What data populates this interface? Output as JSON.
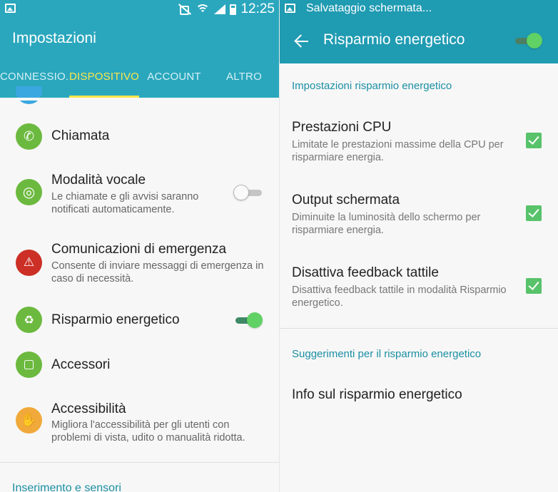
{
  "left": {
    "status": {
      "time": "12:25"
    },
    "app_title": "Impostazioni",
    "tabs": [
      {
        "label": "CONNESSIO..",
        "active": false
      },
      {
        "label": "DISPOSITIVO",
        "active": true
      },
      {
        "label": "ACCOUNT",
        "active": false
      },
      {
        "label": "ALTRO",
        "active": false
      }
    ],
    "items": [
      {
        "title": "Chiamata",
        "icon": "phone-icon",
        "color": "#6cb93f"
      },
      {
        "title": "Modalità vocale",
        "subtitle": "Le chiamate e gli avvisi saranno notificati automaticamente.",
        "icon": "steering-wheel-icon",
        "color": "#6cb93f",
        "toggle": "off"
      },
      {
        "title": "Comunicazioni di emergenza",
        "subtitle": "Consente di inviare messaggi di emergenza in caso di necessità.",
        "icon": "emergency-alert-icon",
        "color": "#cc2f25"
      },
      {
        "title": "Risparmio energetico",
        "icon": "battery-recycle-icon",
        "color": "#6cb93f",
        "toggle": "on"
      },
      {
        "title": "Accessori",
        "icon": "accessory-icon",
        "color": "#6cb93f"
      },
      {
        "title": "Accessibilità",
        "subtitle": "Migliora l'accessibilità per gli utenti con problemi di vista, udito o manualità ridotta.",
        "icon": "hand-icon",
        "color": "#f0a93a"
      }
    ],
    "section_bottom": "Inserimento e sensori"
  },
  "right": {
    "status": {
      "notification": "Salvataggio schermata..."
    },
    "app_title": "Risparmio energetico",
    "master_toggle": "on",
    "section1": "Impostazioni risparmio energetico",
    "options": [
      {
        "title": "Prestazioni CPU",
        "subtitle": "Limitate le prestazioni massime della CPU per risparmiare energia.",
        "checked": true
      },
      {
        "title": "Output schermata",
        "subtitle": "Diminuite la luminosità dello schermo per risparmiare energia.",
        "checked": true
      },
      {
        "title": "Disattiva feedback tattile",
        "subtitle": "Disattiva feedback tattile in modalità Risparmio energetico.",
        "checked": true
      }
    ],
    "section2": "Suggerimenti per il risparmio energetico",
    "info_item": "Info sul risparmio energetico"
  },
  "colors": {
    "appbar": "#2aa7bd",
    "accent_tab": "#fde64b",
    "section_text": "#1b8fa3",
    "checkbox": "#58c36a",
    "switch_on": "#5fd165"
  }
}
